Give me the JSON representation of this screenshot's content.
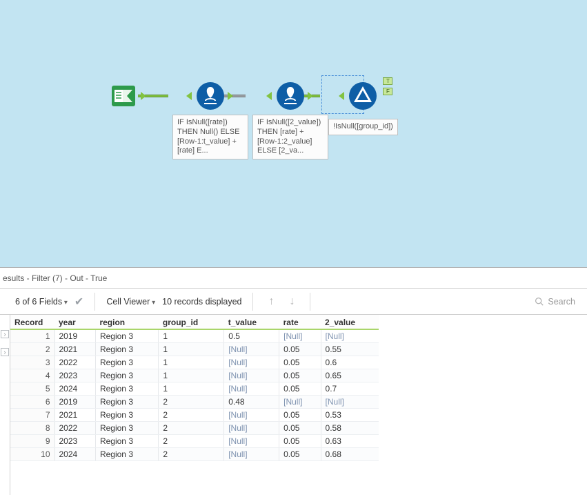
{
  "canvas": {
    "nodes": {
      "input": {
        "label": ""
      },
      "multirow1": {
        "label": "IF IsNull([rate]) THEN Null() ELSE [Row-1:t_value] + [rate] E..."
      },
      "multirow2": {
        "label": "IF IsNull([2_value]) THEN [rate] + [Row-1:2_value] ELSE [2_va..."
      },
      "filter": {
        "label": "!IsNull([group_id])"
      }
    }
  },
  "results_title": "esults - Filter (7) - Out - True",
  "toolbar": {
    "fields": "6 of 6 Fields",
    "cellviewer": "Cell Viewer",
    "records": "10 records displayed",
    "search_placeholder": "Search"
  },
  "columns": [
    "Record",
    "year",
    "region",
    "group_id",
    "t_value",
    "rate",
    "2_value"
  ],
  "rows": [
    {
      "rec": "1",
      "year": "2019",
      "region": "Region 3",
      "group_id": "1",
      "t_value": "0.5",
      "rate": "[Null]",
      "2_value": "[Null]"
    },
    {
      "rec": "2",
      "year": "2021",
      "region": "Region 3",
      "group_id": "1",
      "t_value": "[Null]",
      "rate": "0.05",
      "2_value": "0.55"
    },
    {
      "rec": "3",
      "year": "2022",
      "region": "Region 3",
      "group_id": "1",
      "t_value": "[Null]",
      "rate": "0.05",
      "2_value": "0.6"
    },
    {
      "rec": "4",
      "year": "2023",
      "region": "Region 3",
      "group_id": "1",
      "t_value": "[Null]",
      "rate": "0.05",
      "2_value": "0.65"
    },
    {
      "rec": "5",
      "year": "2024",
      "region": "Region 3",
      "group_id": "1",
      "t_value": "[Null]",
      "rate": "0.05",
      "2_value": "0.7"
    },
    {
      "rec": "6",
      "year": "2019",
      "region": "Region 3",
      "group_id": "2",
      "t_value": "0.48",
      "rate": "[Null]",
      "2_value": "[Null]"
    },
    {
      "rec": "7",
      "year": "2021",
      "region": "Region 3",
      "group_id": "2",
      "t_value": "[Null]",
      "rate": "0.05",
      "2_value": "0.53"
    },
    {
      "rec": "8",
      "year": "2022",
      "region": "Region 3",
      "group_id": "2",
      "t_value": "[Null]",
      "rate": "0.05",
      "2_value": "0.58"
    },
    {
      "rec": "9",
      "year": "2023",
      "region": "Region 3",
      "group_id": "2",
      "t_value": "[Null]",
      "rate": "0.05",
      "2_value": "0.63"
    },
    {
      "rec": "10",
      "year": "2024",
      "region": "Region 3",
      "group_id": "2",
      "t_value": "[Null]",
      "rate": "0.05",
      "2_value": "0.68"
    }
  ]
}
